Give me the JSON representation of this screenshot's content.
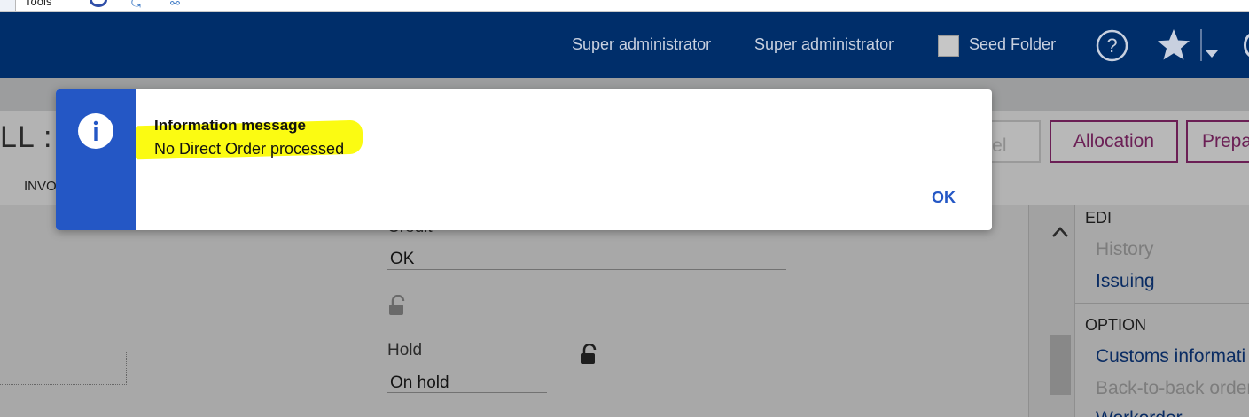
{
  "top_strip": {
    "tool_label": "Tools"
  },
  "header": {
    "user_label_1": "Super administrator",
    "user_label_2": "Super administrator",
    "folder_label": "Seed Folder",
    "background_color": "#002e6a"
  },
  "page": {
    "title_fragment": "LL : F",
    "tab_fragment": "INVO",
    "buttons": {
      "cancel_fragment": "ncel",
      "allocation": "Allocation",
      "preparation_fragment": "Prepa"
    }
  },
  "form": {
    "credit_label": "Credit",
    "credit_value": "OK",
    "hold_label": "Hold",
    "hold_value": "On hold"
  },
  "side_panel": {
    "sections": [
      {
        "heading": "EDI",
        "items": [
          {
            "label": "History",
            "enabled": false
          },
          {
            "label": "Issuing",
            "enabled": true
          }
        ]
      },
      {
        "heading": "OPTION",
        "items": [
          {
            "label": "Customs informati",
            "enabled": true
          },
          {
            "label": "Back-to-back order",
            "enabled": false
          },
          {
            "label": "Workorder",
            "enabled": true
          }
        ]
      }
    ]
  },
  "modal": {
    "title": "Information message",
    "message": "No Direct Order processed",
    "ok_label": "OK",
    "accent_color": "#2457c5",
    "highlight_color": "#fbfb12"
  }
}
